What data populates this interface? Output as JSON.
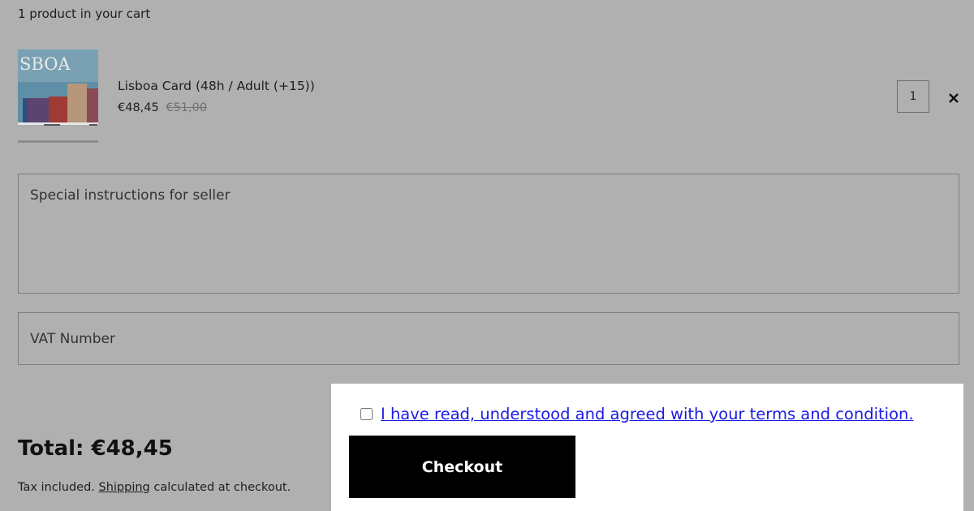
{
  "cart": {
    "count_text": "1 product in your cart"
  },
  "item": {
    "name": "Lisboa Card (48h / Adult (+15))",
    "price": "€48,45",
    "compare_price": "€51,00",
    "quantity": "1",
    "thumbnail_text": "ЅBOA",
    "remove_icon": "close-icon"
  },
  "form": {
    "instructions_placeholder": "Special instructions for seller",
    "vat_placeholder": "VAT Number"
  },
  "summary": {
    "total": "Total: €48,45",
    "tax_prefix": "Tax included. ",
    "shipping_link": "Shipping",
    "tax_suffix": " calculated at checkout."
  },
  "terms": {
    "label": "I have read, understood and agreed with your terms and condition."
  },
  "checkout": {
    "label": "Checkout"
  },
  "colors": {
    "overlay": "#b0b0b0",
    "link": "#1a1ae6",
    "button": "#000000"
  }
}
